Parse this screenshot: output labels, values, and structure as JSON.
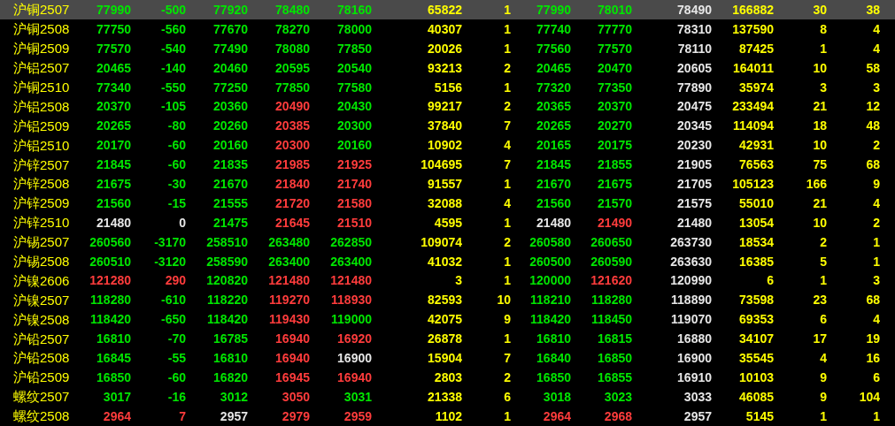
{
  "table": {
    "rows": [
      {
        "name": "沪铜2507",
        "selected": true,
        "cells": [
          {
            "text": "77990",
            "color": "#00e600"
          },
          {
            "text": "-500",
            "color": "#00e600"
          },
          {
            "text": "77920",
            "color": "#00e600"
          },
          {
            "text": "78480",
            "color": "#00e600"
          },
          {
            "text": "78160",
            "color": "#00e600"
          },
          {
            "text": "65822"
          },
          {
            "text": "1"
          },
          {
            "text": "77990",
            "color": "#00e600"
          },
          {
            "text": "78010",
            "color": "#00e600"
          },
          {
            "text": "78490"
          },
          {
            "text": "166882"
          },
          {
            "text": "30"
          },
          {
            "text": "38"
          }
        ]
      },
      {
        "name": "沪铜2508",
        "selected": false,
        "cells": [
          {
            "text": "77750",
            "color": "#00e600"
          },
          {
            "text": "-560",
            "color": "#00e600"
          },
          {
            "text": "77670",
            "color": "#00e600"
          },
          {
            "text": "78270",
            "color": "#00e600"
          },
          {
            "text": "78000",
            "color": "#00e600"
          },
          {
            "text": "40307"
          },
          {
            "text": "1"
          },
          {
            "text": "77740",
            "color": "#00e600"
          },
          {
            "text": "77770",
            "color": "#00e600"
          },
          {
            "text": "78310"
          },
          {
            "text": "137590"
          },
          {
            "text": "8"
          },
          {
            "text": "4"
          }
        ]
      },
      {
        "name": "沪铜2509",
        "selected": false,
        "cells": [
          {
            "text": "77570",
            "color": "#00e600"
          },
          {
            "text": "-540",
            "color": "#00e600"
          },
          {
            "text": "77490",
            "color": "#00e600"
          },
          {
            "text": "78080",
            "color": "#00e600"
          },
          {
            "text": "77850",
            "color": "#00e600"
          },
          {
            "text": "20026"
          },
          {
            "text": "1"
          },
          {
            "text": "77560",
            "color": "#00e600"
          },
          {
            "text": "77570",
            "color": "#00e600"
          },
          {
            "text": "78110"
          },
          {
            "text": "87425"
          },
          {
            "text": "1"
          },
          {
            "text": "4"
          }
        ]
      },
      {
        "name": "沪铝2507",
        "selected": false,
        "cells": [
          {
            "text": "20465",
            "color": "#00e600"
          },
          {
            "text": "-140",
            "color": "#00e600"
          },
          {
            "text": "20460",
            "color": "#00e600"
          },
          {
            "text": "20595",
            "color": "#00e600"
          },
          {
            "text": "20540",
            "color": "#00e600"
          },
          {
            "text": "93213"
          },
          {
            "text": "2"
          },
          {
            "text": "20465",
            "color": "#00e600"
          },
          {
            "text": "20470",
            "color": "#00e600"
          },
          {
            "text": "20605"
          },
          {
            "text": "164011"
          },
          {
            "text": "10"
          },
          {
            "text": "58"
          }
        ]
      },
      {
        "name": "沪铜2510",
        "selected": false,
        "cells": [
          {
            "text": "77340",
            "color": "#00e600"
          },
          {
            "text": "-550",
            "color": "#00e600"
          },
          {
            "text": "77250",
            "color": "#00e600"
          },
          {
            "text": "77850",
            "color": "#00e600"
          },
          {
            "text": "77580",
            "color": "#00e600"
          },
          {
            "text": "5156"
          },
          {
            "text": "1"
          },
          {
            "text": "77320",
            "color": "#00e600"
          },
          {
            "text": "77350",
            "color": "#00e600"
          },
          {
            "text": "77890"
          },
          {
            "text": "35974"
          },
          {
            "text": "3"
          },
          {
            "text": "3"
          }
        ]
      },
      {
        "name": "沪铝2508",
        "selected": false,
        "cells": [
          {
            "text": "20370",
            "color": "#00e600"
          },
          {
            "text": "-105",
            "color": "#00e600"
          },
          {
            "text": "20360",
            "color": "#00e600"
          },
          {
            "text": "20490",
            "color": "#ff3c3c"
          },
          {
            "text": "20430",
            "color": "#00e600"
          },
          {
            "text": "99217"
          },
          {
            "text": "2"
          },
          {
            "text": "20365",
            "color": "#00e600"
          },
          {
            "text": "20370",
            "color": "#00e600"
          },
          {
            "text": "20475"
          },
          {
            "text": "233494"
          },
          {
            "text": "21"
          },
          {
            "text": "12"
          }
        ]
      },
      {
        "name": "沪铝2509",
        "selected": false,
        "cells": [
          {
            "text": "20265",
            "color": "#00e600"
          },
          {
            "text": "-80",
            "color": "#00e600"
          },
          {
            "text": "20260",
            "color": "#00e600"
          },
          {
            "text": "20385",
            "color": "#ff3c3c"
          },
          {
            "text": "20300",
            "color": "#00e600"
          },
          {
            "text": "37840"
          },
          {
            "text": "7"
          },
          {
            "text": "20265",
            "color": "#00e600"
          },
          {
            "text": "20270",
            "color": "#00e600"
          },
          {
            "text": "20345"
          },
          {
            "text": "114094"
          },
          {
            "text": "18"
          },
          {
            "text": "48"
          }
        ]
      },
      {
        "name": "沪铝2510",
        "selected": false,
        "cells": [
          {
            "text": "20170",
            "color": "#00e600"
          },
          {
            "text": "-60",
            "color": "#00e600"
          },
          {
            "text": "20160",
            "color": "#00e600"
          },
          {
            "text": "20300",
            "color": "#ff3c3c"
          },
          {
            "text": "20160",
            "color": "#00e600"
          },
          {
            "text": "10902"
          },
          {
            "text": "4"
          },
          {
            "text": "20165",
            "color": "#00e600"
          },
          {
            "text": "20175",
            "color": "#00e600"
          },
          {
            "text": "20230"
          },
          {
            "text": "42931"
          },
          {
            "text": "10"
          },
          {
            "text": "2"
          }
        ]
      },
      {
        "name": "沪锌2507",
        "selected": false,
        "cells": [
          {
            "text": "21845",
            "color": "#00e600"
          },
          {
            "text": "-60",
            "color": "#00e600"
          },
          {
            "text": "21835",
            "color": "#00e600"
          },
          {
            "text": "21985",
            "color": "#ff3c3c"
          },
          {
            "text": "21925",
            "color": "#ff3c3c"
          },
          {
            "text": "104695"
          },
          {
            "text": "7"
          },
          {
            "text": "21845",
            "color": "#00e600"
          },
          {
            "text": "21855",
            "color": "#00e600"
          },
          {
            "text": "21905"
          },
          {
            "text": "76563"
          },
          {
            "text": "75"
          },
          {
            "text": "68"
          }
        ]
      },
      {
        "name": "沪锌2508",
        "selected": false,
        "cells": [
          {
            "text": "21675",
            "color": "#00e600"
          },
          {
            "text": "-30",
            "color": "#00e600"
          },
          {
            "text": "21670",
            "color": "#00e600"
          },
          {
            "text": "21840",
            "color": "#ff3c3c"
          },
          {
            "text": "21740",
            "color": "#ff3c3c"
          },
          {
            "text": "91557"
          },
          {
            "text": "1"
          },
          {
            "text": "21670",
            "color": "#00e600"
          },
          {
            "text": "21675",
            "color": "#00e600"
          },
          {
            "text": "21705"
          },
          {
            "text": "105123"
          },
          {
            "text": "166"
          },
          {
            "text": "9"
          }
        ]
      },
      {
        "name": "沪锌2509",
        "selected": false,
        "cells": [
          {
            "text": "21560",
            "color": "#00e600"
          },
          {
            "text": "-15",
            "color": "#00e600"
          },
          {
            "text": "21555",
            "color": "#00e600"
          },
          {
            "text": "21720",
            "color": "#ff3c3c"
          },
          {
            "text": "21580",
            "color": "#ff3c3c"
          },
          {
            "text": "32088"
          },
          {
            "text": "4"
          },
          {
            "text": "21560",
            "color": "#00e600"
          },
          {
            "text": "21570",
            "color": "#00e600"
          },
          {
            "text": "21575"
          },
          {
            "text": "55010"
          },
          {
            "text": "21"
          },
          {
            "text": "4"
          }
        ]
      },
      {
        "name": "沪锌2510",
        "selected": false,
        "cells": [
          {
            "text": "21480",
            "color": "#e6e6e6"
          },
          {
            "text": "0",
            "color": "#e6e6e6"
          },
          {
            "text": "21475",
            "color": "#00e600"
          },
          {
            "text": "21645",
            "color": "#ff3c3c"
          },
          {
            "text": "21510",
            "color": "#ff3c3c"
          },
          {
            "text": "4595"
          },
          {
            "text": "1"
          },
          {
            "text": "21480",
            "color": "#e6e6e6"
          },
          {
            "text": "21490",
            "color": "#ff3c3c"
          },
          {
            "text": "21480"
          },
          {
            "text": "13054"
          },
          {
            "text": "10"
          },
          {
            "text": "2"
          }
        ]
      },
      {
        "name": "沪锡2507",
        "selected": false,
        "cells": [
          {
            "text": "260560",
            "color": "#00e600"
          },
          {
            "text": "-3170",
            "color": "#00e600"
          },
          {
            "text": "258510",
            "color": "#00e600"
          },
          {
            "text": "263480",
            "color": "#00e600"
          },
          {
            "text": "262850",
            "color": "#00e600"
          },
          {
            "text": "109074"
          },
          {
            "text": "2"
          },
          {
            "text": "260580",
            "color": "#00e600"
          },
          {
            "text": "260650",
            "color": "#00e600"
          },
          {
            "text": "263730"
          },
          {
            "text": "18534"
          },
          {
            "text": "2"
          },
          {
            "text": "1"
          }
        ]
      },
      {
        "name": "沪锡2508",
        "selected": false,
        "cells": [
          {
            "text": "260510",
            "color": "#00e600"
          },
          {
            "text": "-3120",
            "color": "#00e600"
          },
          {
            "text": "258590",
            "color": "#00e600"
          },
          {
            "text": "263400",
            "color": "#00e600"
          },
          {
            "text": "263400",
            "color": "#00e600"
          },
          {
            "text": "41032"
          },
          {
            "text": "1"
          },
          {
            "text": "260500",
            "color": "#00e600"
          },
          {
            "text": "260590",
            "color": "#00e600"
          },
          {
            "text": "263630"
          },
          {
            "text": "16385"
          },
          {
            "text": "5"
          },
          {
            "text": "1"
          }
        ]
      },
      {
        "name": "沪镍2606",
        "selected": false,
        "cells": [
          {
            "text": "121280",
            "color": "#ff3c3c"
          },
          {
            "text": "290",
            "color": "#ff3c3c"
          },
          {
            "text": "120820",
            "color": "#00e600"
          },
          {
            "text": "121480",
            "color": "#ff3c3c"
          },
          {
            "text": "121480",
            "color": "#ff3c3c"
          },
          {
            "text": "3"
          },
          {
            "text": "1"
          },
          {
            "text": "120000",
            "color": "#00e600"
          },
          {
            "text": "121620",
            "color": "#ff3c3c"
          },
          {
            "text": "120990"
          },
          {
            "text": "6"
          },
          {
            "text": "1"
          },
          {
            "text": "3"
          }
        ]
      },
      {
        "name": "沪镍2507",
        "selected": false,
        "cells": [
          {
            "text": "118280",
            "color": "#00e600"
          },
          {
            "text": "-610",
            "color": "#00e600"
          },
          {
            "text": "118220",
            "color": "#00e600"
          },
          {
            "text": "119270",
            "color": "#ff3c3c"
          },
          {
            "text": "118930",
            "color": "#ff3c3c"
          },
          {
            "text": "82593"
          },
          {
            "text": "10"
          },
          {
            "text": "118210",
            "color": "#00e600"
          },
          {
            "text": "118280",
            "color": "#00e600"
          },
          {
            "text": "118890"
          },
          {
            "text": "73598"
          },
          {
            "text": "23"
          },
          {
            "text": "68"
          }
        ]
      },
      {
        "name": "沪镍2508",
        "selected": false,
        "cells": [
          {
            "text": "118420",
            "color": "#00e600"
          },
          {
            "text": "-650",
            "color": "#00e600"
          },
          {
            "text": "118420",
            "color": "#00e600"
          },
          {
            "text": "119430",
            "color": "#ff3c3c"
          },
          {
            "text": "119000",
            "color": "#00e600"
          },
          {
            "text": "42075"
          },
          {
            "text": "9"
          },
          {
            "text": "118420",
            "color": "#00e600"
          },
          {
            "text": "118450",
            "color": "#00e600"
          },
          {
            "text": "119070"
          },
          {
            "text": "69353"
          },
          {
            "text": "6"
          },
          {
            "text": "4"
          }
        ]
      },
      {
        "name": "沪铅2507",
        "selected": false,
        "cells": [
          {
            "text": "16810",
            "color": "#00e600"
          },
          {
            "text": "-70",
            "color": "#00e600"
          },
          {
            "text": "16785",
            "color": "#00e600"
          },
          {
            "text": "16940",
            "color": "#ff3c3c"
          },
          {
            "text": "16920",
            "color": "#ff3c3c"
          },
          {
            "text": "26878"
          },
          {
            "text": "1"
          },
          {
            "text": "16810",
            "color": "#00e600"
          },
          {
            "text": "16815",
            "color": "#00e600"
          },
          {
            "text": "16880"
          },
          {
            "text": "34107"
          },
          {
            "text": "17"
          },
          {
            "text": "19"
          }
        ]
      },
      {
        "name": "沪铅2508",
        "selected": false,
        "cells": [
          {
            "text": "16845",
            "color": "#00e600"
          },
          {
            "text": "-55",
            "color": "#00e600"
          },
          {
            "text": "16810",
            "color": "#00e600"
          },
          {
            "text": "16940",
            "color": "#ff3c3c"
          },
          {
            "text": "16900",
            "color": "#e6e6e6"
          },
          {
            "text": "15904"
          },
          {
            "text": "7"
          },
          {
            "text": "16840",
            "color": "#00e600"
          },
          {
            "text": "16850",
            "color": "#00e600"
          },
          {
            "text": "16900"
          },
          {
            "text": "35545"
          },
          {
            "text": "4"
          },
          {
            "text": "16"
          }
        ]
      },
      {
        "name": "沪铅2509",
        "selected": false,
        "cells": [
          {
            "text": "16850",
            "color": "#00e600"
          },
          {
            "text": "-60",
            "color": "#00e600"
          },
          {
            "text": "16820",
            "color": "#00e600"
          },
          {
            "text": "16945",
            "color": "#ff3c3c"
          },
          {
            "text": "16940",
            "color": "#ff3c3c"
          },
          {
            "text": "2803"
          },
          {
            "text": "2"
          },
          {
            "text": "16850",
            "color": "#00e600"
          },
          {
            "text": "16855",
            "color": "#00e600"
          },
          {
            "text": "16910"
          },
          {
            "text": "10103"
          },
          {
            "text": "9"
          },
          {
            "text": "6"
          }
        ]
      },
      {
        "name": "螺纹2507",
        "selected": false,
        "cells": [
          {
            "text": "3017",
            "color": "#00e600"
          },
          {
            "text": "-16",
            "color": "#00e600"
          },
          {
            "text": "3012",
            "color": "#00e600"
          },
          {
            "text": "3050",
            "color": "#ff3c3c"
          },
          {
            "text": "3031",
            "color": "#00e600"
          },
          {
            "text": "21338"
          },
          {
            "text": "6"
          },
          {
            "text": "3018",
            "color": "#00e600"
          },
          {
            "text": "3023",
            "color": "#00e600"
          },
          {
            "text": "3033"
          },
          {
            "text": "46085"
          },
          {
            "text": "9"
          },
          {
            "text": "104"
          }
        ]
      },
      {
        "name": "螺纹2508",
        "selected": false,
        "cells": [
          {
            "text": "2964",
            "color": "#ff3c3c"
          },
          {
            "text": "7",
            "color": "#ff3c3c"
          },
          {
            "text": "2957",
            "color": "#e6e6e6"
          },
          {
            "text": "2979",
            "color": "#ff3c3c"
          },
          {
            "text": "2959",
            "color": "#ff3c3c"
          },
          {
            "text": "1102"
          },
          {
            "text": "1"
          },
          {
            "text": "2964",
            "color": "#ff3c3c"
          },
          {
            "text": "2968",
            "color": "#ff3c3c"
          },
          {
            "text": "2957"
          },
          {
            "text": "5145"
          },
          {
            "text": "1"
          },
          {
            "text": "1"
          }
        ]
      }
    ]
  }
}
